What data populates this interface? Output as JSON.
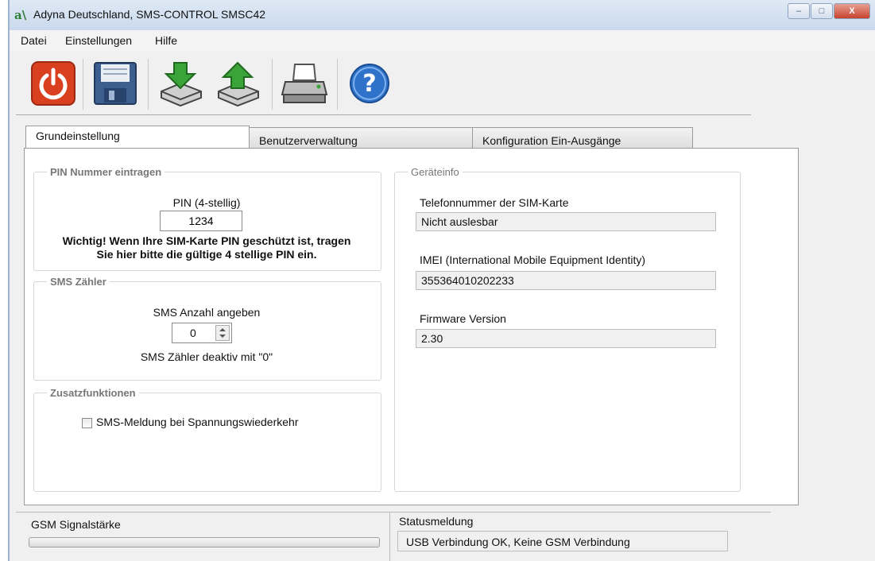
{
  "window": {
    "title": "Adyna Deutschland, SMS-CONTROL SMSC42",
    "app_icon_text": "a\\",
    "controls": {
      "minimize": "–",
      "maximize": "□",
      "close": "X"
    }
  },
  "menu": {
    "items": [
      "Datei",
      "Einstellungen",
      "Hilfe"
    ]
  },
  "toolbar": {
    "buttons": [
      {
        "icon": "power-icon"
      },
      {
        "icon": "save-icon"
      },
      {
        "icon": "download-icon"
      },
      {
        "icon": "upload-icon"
      },
      {
        "icon": "printer-icon"
      },
      {
        "icon": "help-icon"
      }
    ],
    "help_glyph": "?"
  },
  "tabs": [
    {
      "label": "Grundeinstellung",
      "active": true
    },
    {
      "label": "Benutzerverwaltung",
      "active": false
    },
    {
      "label": "Konfiguration Ein-Ausgänge",
      "active": false
    }
  ],
  "pin_group": {
    "legend": "PIN Nummer eintragen",
    "label": "PIN (4-stellig)",
    "value": "1234",
    "note_line1": "Wichtig! Wenn Ihre SIM-Karte PIN geschützt ist, tragen",
    "note_line2": "Sie hier bitte die gültige 4 stellige PIN ein."
  },
  "sms_group": {
    "legend": "SMS Zähler",
    "label": "SMS Anzahl angeben",
    "value": "0",
    "hint": "SMS Zähler deaktiv mit \"0\""
  },
  "extra_group": {
    "legend": "Zusatzfunktionen",
    "checkbox_label": "SMS-Meldung bei Spannungswiederkehr",
    "checked": false
  },
  "device_group": {
    "legend": "Geräteinfo",
    "phone_label": "Telefonnummer der SIM-Karte",
    "phone_value": "Nicht auslesbar",
    "imei_label": "IMEI (International Mobile Equipment Identity)",
    "imei_value": "355364010202233",
    "firmware_label": "Firmware Version",
    "firmware_value": "2.30"
  },
  "status": {
    "signal_label": "GSM Signalstärke",
    "signal_level": 0,
    "message_label": "Statusmeldung",
    "message_value": "USB Verbindung OK, Keine GSM Verbindung"
  },
  "colors": {
    "power_red": "#d9401f",
    "save_blue": "#3d5f8f",
    "arrow_green": "#3aa33a",
    "help_blue": "#2f72c9"
  }
}
